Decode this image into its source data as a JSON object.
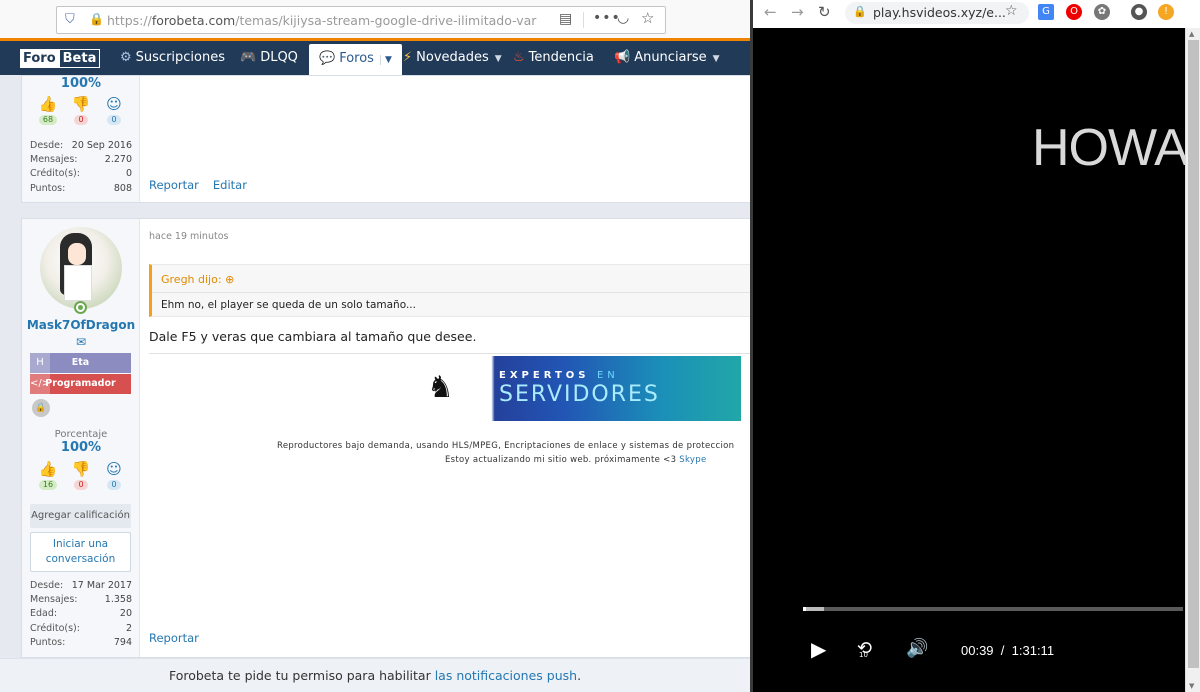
{
  "left_browser": {
    "url_prefix": "https://",
    "url_domain": "forobeta.com",
    "url_path": "/temas/kijiysa-stream-google-drive-ilimitado-varios-servidores-m"
  },
  "navbar": {
    "logo_part1": "Foro",
    "logo_part2": "Beta",
    "items": [
      {
        "label": "Suscripciones",
        "icon": "puzzle-icon"
      },
      {
        "label": "DLQQ",
        "icon": "gamepad-icon"
      },
      {
        "label": "Foros",
        "icon": "chat-icon"
      },
      {
        "label": "Novedades",
        "icon": "bolt-icon"
      },
      {
        "label": "Tendencia",
        "icon": "fire-icon"
      },
      {
        "label": "Anunciarse",
        "icon": "megaphone-icon"
      }
    ]
  },
  "post1": {
    "percent": "100%",
    "reactions": {
      "like": "68",
      "dislike": "0",
      "neutral": "0"
    },
    "stats": [
      {
        "label": "Desde:",
        "value": "20 Sep 2016"
      },
      {
        "label": "Mensajes:",
        "value": "2.270"
      },
      {
        "label": "Crédito(s):",
        "value": "0"
      },
      {
        "label": "Puntos:",
        "value": "808"
      }
    ],
    "actions": [
      "Reportar",
      "Editar"
    ]
  },
  "post2": {
    "username": "Mask7OfDragon",
    "banner1": "Eta",
    "banner2": "Programador",
    "percent_label": "Porcentaje",
    "percent": "100%",
    "reactions": {
      "like": "16",
      "dislike": "0",
      "neutral": "0"
    },
    "rate_button": "Agregar calificación",
    "conv_button_line1": "Iniciar una",
    "conv_button_line2": "conversación",
    "stats": [
      {
        "label": "Desde:",
        "value": "17 Mar 2017"
      },
      {
        "label": "Mensajes:",
        "value": "1.358"
      },
      {
        "label": "Edad:",
        "value": "20"
      },
      {
        "label": "Crédito(s):",
        "value": "2"
      },
      {
        "label": "Puntos:",
        "value": "794"
      }
    ],
    "time": "hace 19 minutos",
    "quote_author": "Gregh dijo:",
    "quote_text": "Ehm no, el player se queda de un solo tamaño...",
    "message": "Dale F5 y veras que cambiara al tamaño que desee.",
    "ad_line1_a": "EXPERTOS",
    "ad_line1_b": "EN",
    "ad_line2": "SERVIDORES",
    "sig_line1": "Reproductores bajo demanda, usando HLS/MPEG, Encriptaciones de enlace y sistemas de proteccion",
    "sig_line2_text": "Estoy actualizando mi sitio web. próximamente <3",
    "sig_line2_link": "Skype",
    "actions": [
      "Reportar"
    ]
  },
  "push_bar": {
    "text": "Forobeta te pide tu permiso para habilitar",
    "link": "las notificaciones push",
    "suffix": "."
  },
  "right_browser": {
    "url": "play.hsvideos.xyz/e..."
  },
  "player": {
    "title_text": "HOWA",
    "current_time": "00:39",
    "separator": "/",
    "duration": "1:31:11",
    "progress_fraction": 0.0071,
    "buffered_fraction": 0.055,
    "rewind_seconds": "10"
  }
}
